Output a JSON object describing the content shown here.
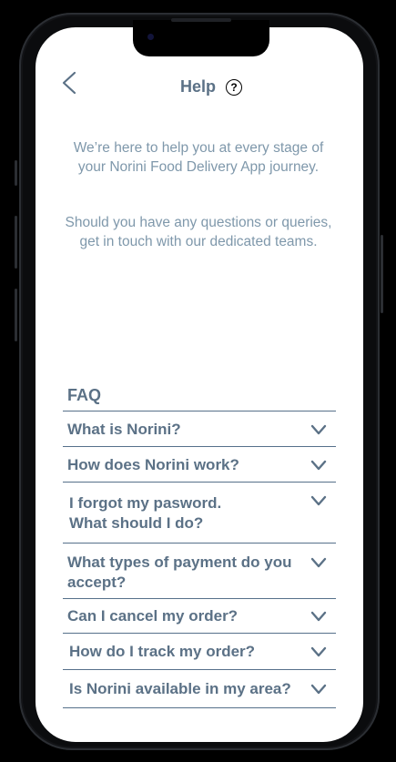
{
  "header": {
    "title": "Help",
    "help_icon_glyph": "?"
  },
  "intro": {
    "paragraph1": "We’re here to help you at every stage of your Norini Food Delivery App journey.",
    "paragraph2": "Should you have any questions or queries, get in touch with our dedicated teams."
  },
  "faq": {
    "title": "FAQ",
    "items": [
      {
        "question": "What is Norini?"
      },
      {
        "question": "How does Norini work?"
      },
      {
        "question": "I forgot my pasword. What should I do?"
      },
      {
        "question": "What types of payment do you accept?"
      },
      {
        "question": "Can I cancel my order?"
      },
      {
        "question": "How do I track my order?"
      },
      {
        "question": "Is Norini available in my area?"
      }
    ]
  },
  "colors": {
    "accent": "#5b7186",
    "muted_text": "#7f98ab",
    "divider": "#56708a",
    "background": "#ffffff"
  },
  "icons": {
    "back": "chevron-left-icon",
    "help": "question-circle-icon",
    "expand": "chevron-down-icon"
  }
}
